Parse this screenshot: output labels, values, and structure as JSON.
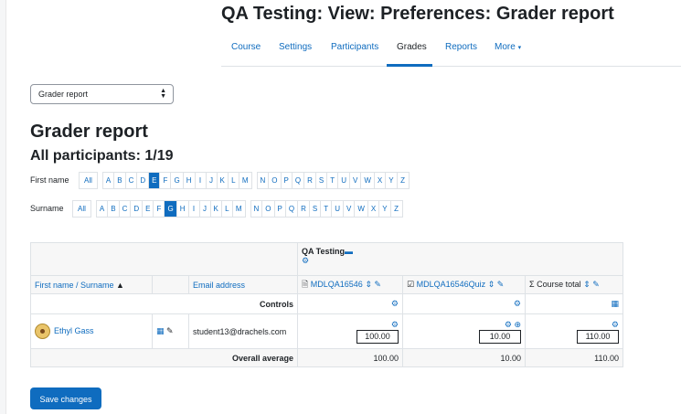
{
  "page": {
    "title": "QA Testing: View: Preferences: Grader report"
  },
  "nav": {
    "tabs": [
      {
        "label": "Course"
      },
      {
        "label": "Settings"
      },
      {
        "label": "Participants"
      },
      {
        "label": "Grades"
      },
      {
        "label": "Reports"
      },
      {
        "label": "More"
      }
    ],
    "active": "Grades"
  },
  "report_select": {
    "value": "Grader report"
  },
  "heading": "Grader report",
  "participants": "All participants: 1/19",
  "firstname_filter": {
    "label": "First name",
    "all": "All",
    "letters": [
      "A",
      "B",
      "C",
      "D",
      "E",
      "F",
      "G",
      "H",
      "I",
      "J",
      "K",
      "L",
      "M",
      "N",
      "O",
      "P",
      "Q",
      "R",
      "S",
      "T",
      "U",
      "V",
      "W",
      "X",
      "Y",
      "Z"
    ],
    "active": "E"
  },
  "surname_filter": {
    "label": "Surname",
    "all": "All",
    "letters": [
      "A",
      "B",
      "C",
      "D",
      "E",
      "F",
      "G",
      "H",
      "I",
      "J",
      "K",
      "L",
      "M",
      "N",
      "O",
      "P",
      "Q",
      "R",
      "S",
      "T",
      "U",
      "V",
      "W",
      "X",
      "Y",
      "Z"
    ],
    "active": "G"
  },
  "table": {
    "category": "QA Testing",
    "col_name": "First name / Surname",
    "col_email": "Email address",
    "items": [
      "MDLQA16546",
      "MDLQA16546Quiz",
      "Course total"
    ],
    "controls_label": "Controls",
    "student": {
      "name": "Ethyl Gass",
      "email": "student13@drachels.com",
      "grades": [
        "100.00",
        "10.00",
        "110.00"
      ]
    },
    "overall_label": "Overall average",
    "averages": [
      "100.00",
      "10.00",
      "110.00"
    ]
  },
  "save_button": "Save changes",
  "colors": {
    "primary": "#0f6cbf",
    "border": "#dee2e6"
  }
}
